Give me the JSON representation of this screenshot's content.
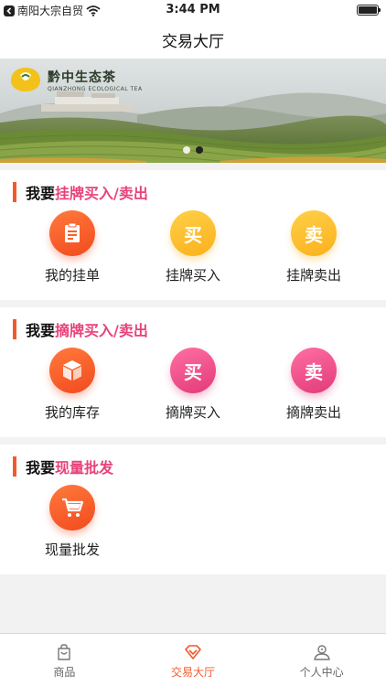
{
  "status_bar": {
    "carrier": "南阳大宗自贸",
    "time": "3:44 PM",
    "back_icon": "back-arrow-icon",
    "wifi_icon": "wifi-icon",
    "battery_icon": "battery-icon"
  },
  "nav": {
    "title": "交易大厅"
  },
  "banner": {
    "brand_name": "黔中生态茶",
    "brand_en": "QIANZHONG ECOLOGICAL TEA",
    "slide_count": 2,
    "active_slide": 2
  },
  "sections": [
    {
      "prefix": "我要",
      "highlight": "挂牌买入/卖出",
      "items": [
        {
          "label": "我的挂单",
          "icon": "clipboard-icon",
          "glyph": "",
          "color": "orange"
        },
        {
          "label": "挂牌买入",
          "icon": "buy-icon",
          "glyph": "买",
          "color": "yellow"
        },
        {
          "label": "挂牌卖出",
          "icon": "sell-icon",
          "glyph": "卖",
          "color": "yellow"
        }
      ]
    },
    {
      "prefix": "我要",
      "highlight": "摘牌买入/卖出",
      "items": [
        {
          "label": "我的库存",
          "icon": "box-icon",
          "glyph": "",
          "color": "orange"
        },
        {
          "label": "摘牌买入",
          "icon": "buy-icon",
          "glyph": "买",
          "color": "pink"
        },
        {
          "label": "摘牌卖出",
          "icon": "sell-icon",
          "glyph": "卖",
          "color": "pink"
        }
      ]
    },
    {
      "prefix": "我要",
      "highlight": "现量批发",
      "items": [
        {
          "label": "现量批发",
          "icon": "cart-icon",
          "glyph": "",
          "color": "orange"
        }
      ]
    }
  ],
  "colors": {
    "accent": "#f25a2b",
    "highlight": "#e8427a",
    "yellow": "#fbb01c",
    "pink": "#e23a78"
  },
  "tabs": [
    {
      "label": "商品",
      "icon": "bag-icon",
      "active": false
    },
    {
      "label": "交易大厅",
      "icon": "diamond-icon",
      "active": true
    },
    {
      "label": "个人中心",
      "icon": "person-icon",
      "active": false
    }
  ]
}
